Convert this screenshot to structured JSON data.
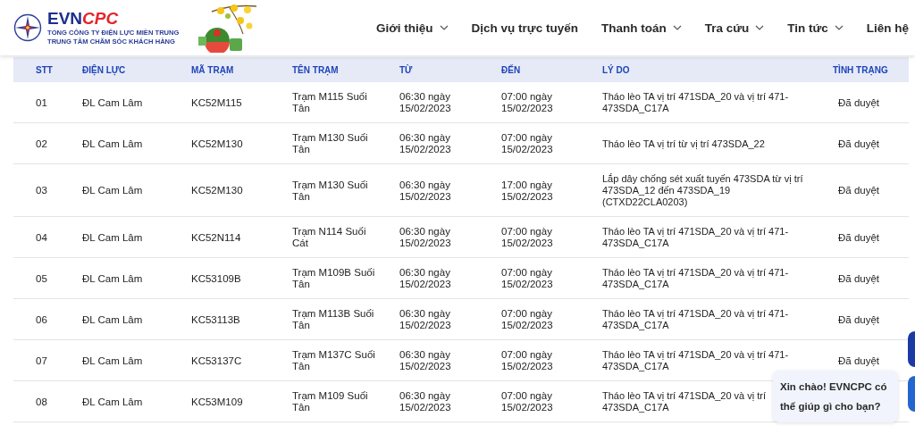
{
  "header": {
    "logo": {
      "brand_main": "EVN",
      "brand_accent": "CPC",
      "line_1": "TỔNG CÔNG TY ĐIỆN LỰC MIỀN TRUNG",
      "line_2": "TRUNG TÂM CHĂM SÓC KHÁCH HÀNG"
    },
    "nav": [
      {
        "label": "Giới thiệu",
        "has_dropdown": true
      },
      {
        "label": "Dịch vụ trực tuyến",
        "has_dropdown": false
      },
      {
        "label": "Thanh toán",
        "has_dropdown": true
      },
      {
        "label": "Tra cứu",
        "has_dropdown": true
      },
      {
        "label": "Tin tức",
        "has_dropdown": true
      },
      {
        "label": "Liên hệ",
        "has_dropdown": false
      }
    ]
  },
  "table": {
    "columns": [
      "STT",
      "ĐIỆN LỰC",
      "MÃ TRẠM",
      "TÊN TRẠM",
      "TỪ",
      "ĐẾN",
      "LÝ DO",
      "TÌNH TRẠNG"
    ],
    "rows": [
      [
        "01",
        "ĐL Cam Lâm",
        "KC52M115",
        "Trạm M115 Suối Tân",
        "06:30 ngày 15/02/2023",
        "07:00 ngày 15/02/2023",
        "Tháo lèo TA vị trí 471SDA_20 và vị trí 471-473SDA_C17A",
        "Đã duyệt"
      ],
      [
        "02",
        "ĐL Cam Lâm",
        "KC52M130",
        "Trạm M130 Suối Tân",
        "06:30 ngày 15/02/2023",
        "07:00 ngày 15/02/2023",
        "Tháo lèo TA vị trí từ vị trí 473SDA_22",
        "Đã duyệt"
      ],
      [
        "03",
        "ĐL Cam Lâm",
        "KC52M130",
        "Trạm M130 Suối Tân",
        "06:30 ngày 15/02/2023",
        "17:00 ngày 15/02/2023",
        "Lắp dây chống sét xuất tuyến 473SDA từ vị trí 473SDA_12 đến 473SDA_19 (CTXD22CLA0203)",
        "Đã duyệt"
      ],
      [
        "04",
        "ĐL Cam Lâm",
        "KC52N114",
        "Trạm N114 Suối Cát",
        "06:30 ngày 15/02/2023",
        "07:00 ngày 15/02/2023",
        "Tháo lèo TA vị trí 471SDA_20 và vị trí 471-473SDA_C17A",
        "Đã duyệt"
      ],
      [
        "05",
        "ĐL Cam Lâm",
        "KC53109B",
        "Trạm M109B Suối Tân",
        "06:30 ngày 15/02/2023",
        "07:00 ngày 15/02/2023",
        "Tháo lèo TA vị trí 471SDA_20 và vị trí 471-473SDA_C17A",
        "Đã duyệt"
      ],
      [
        "06",
        "ĐL Cam Lâm",
        "KC53113B",
        "Trạm M113B Suối Tân",
        "06:30 ngày 15/02/2023",
        "07:00 ngày 15/02/2023",
        "Tháo lèo TA vị trí 471SDA_20 và vị trí 471-473SDA_C17A",
        "Đã duyệt"
      ],
      [
        "07",
        "ĐL Cam Lâm",
        "KC53137C",
        "Trạm M137C Suối Tân",
        "06:30 ngày 15/02/2023",
        "07:00 ngày 15/02/2023",
        "Tháo lèo TA vị trí 471SDA_20 và vị trí 471-473SDA_C17A",
        "Đã duyệt"
      ],
      [
        "08",
        "ĐL Cam Lâm",
        "KC53M109",
        "Trạm M109 Suối Tân",
        "06:30 ngày 15/02/2023",
        "07:00 ngày 15/02/2023",
        [
          "Tháo lèo TA vị trí 471SDA_20 và vị trí",
          "473SDA_C17A"
        ]
      ]
    ]
  },
  "chat_bubble": {
    "text": "Xin chào! EVNCPC có thể giúp gì cho bạn?"
  }
}
